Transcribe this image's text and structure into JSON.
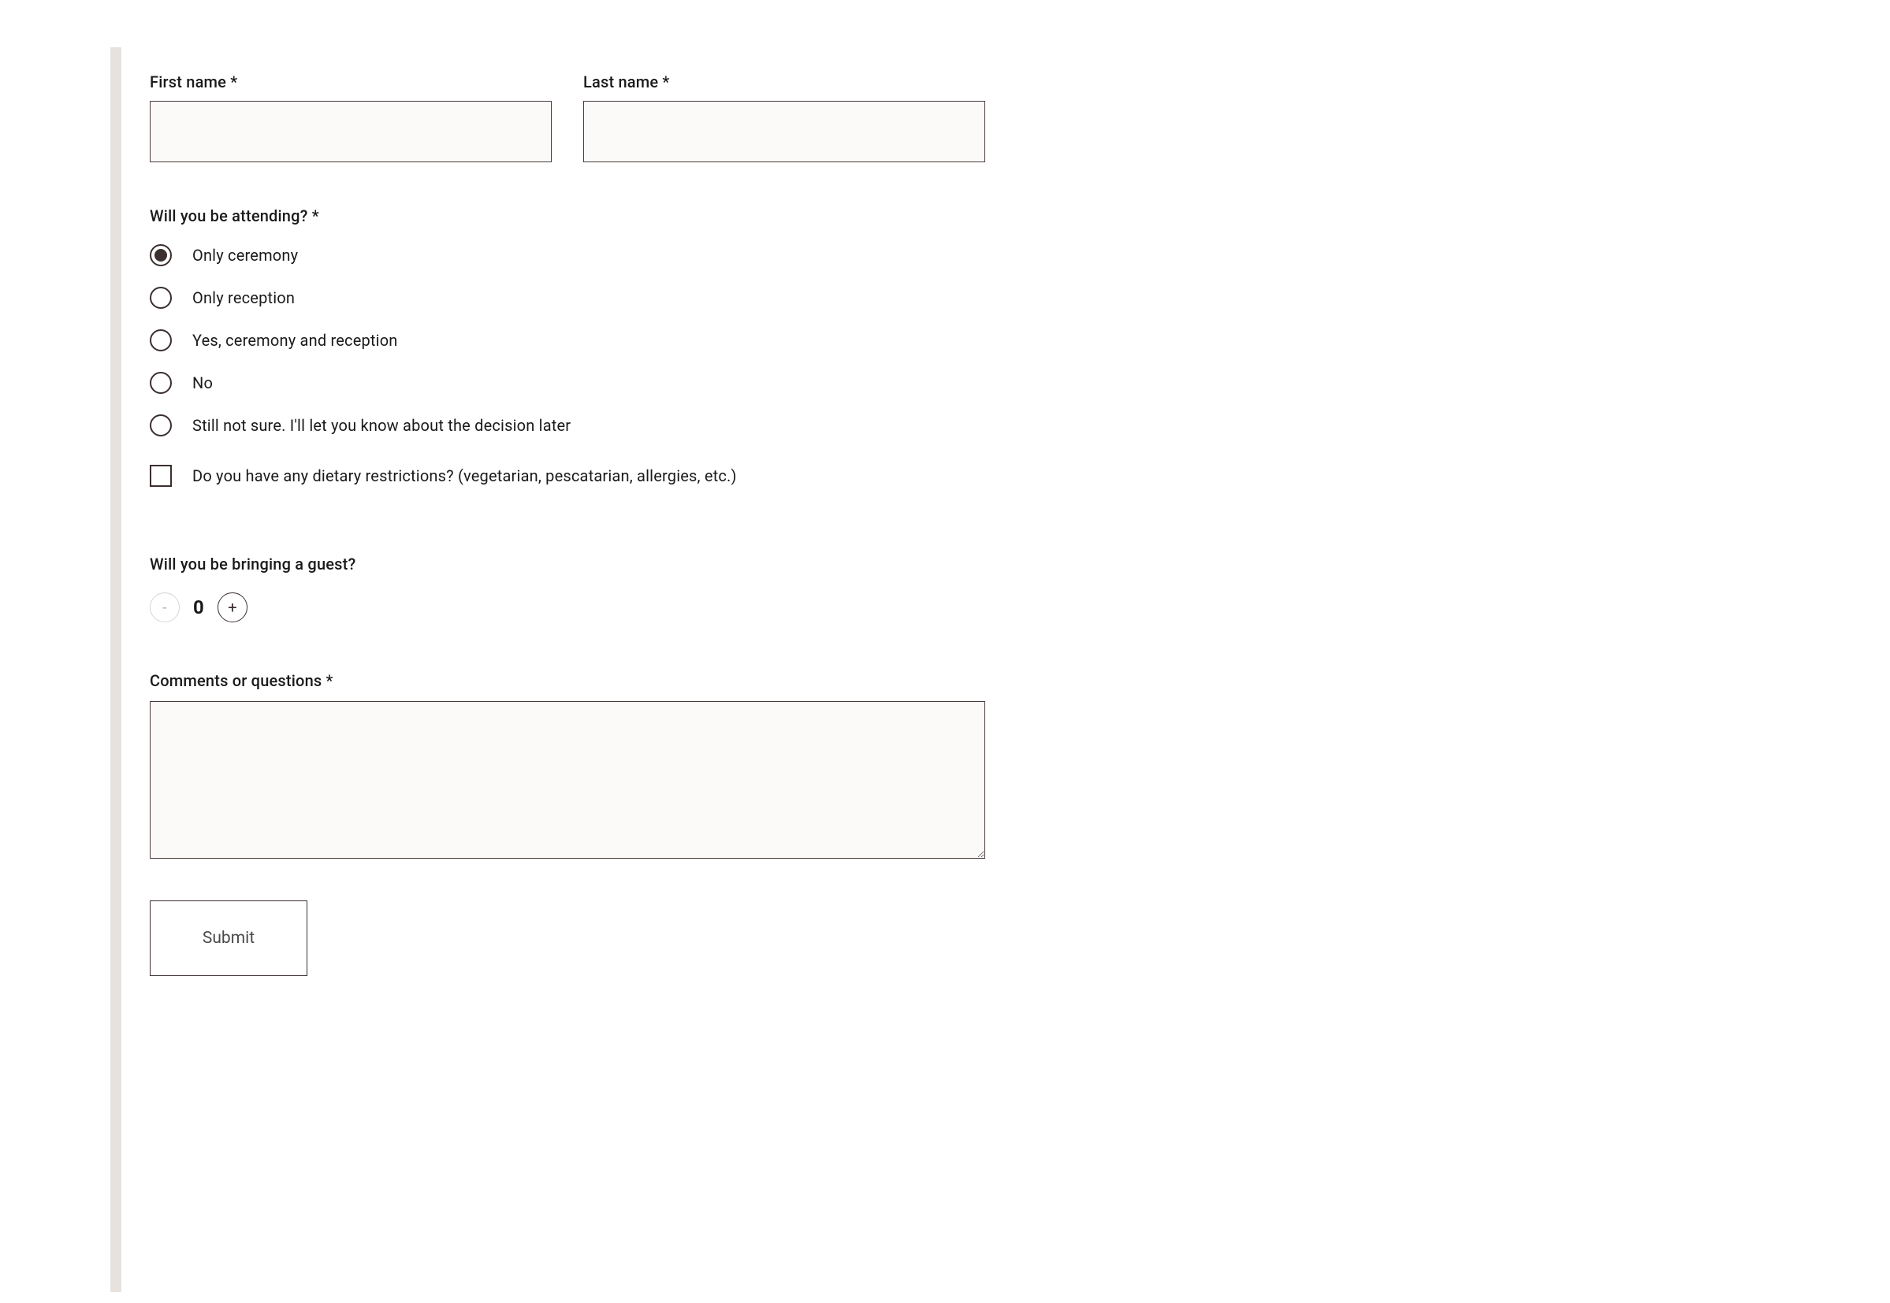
{
  "form": {
    "first_name": {
      "label": "First name *",
      "value": ""
    },
    "last_name": {
      "label": "Last name *",
      "value": ""
    },
    "attending": {
      "label": "Will you be attending? *",
      "selected_index": 0,
      "options": [
        "Only ceremony",
        "Only reception",
        "Yes, ceremony and reception",
        "No",
        "Still not sure. I'll let you know about the decision later"
      ]
    },
    "dietary": {
      "label": "Do you have any dietary restrictions? (vegetarian, pescatarian, allergies, etc.)",
      "checked": false
    },
    "guest": {
      "label": "Will you be bringing a guest?",
      "value": "0",
      "minus_glyph": "-",
      "plus_glyph": "+"
    },
    "comments": {
      "label": "Comments or questions *",
      "value": ""
    },
    "submit_label": "Submit"
  }
}
